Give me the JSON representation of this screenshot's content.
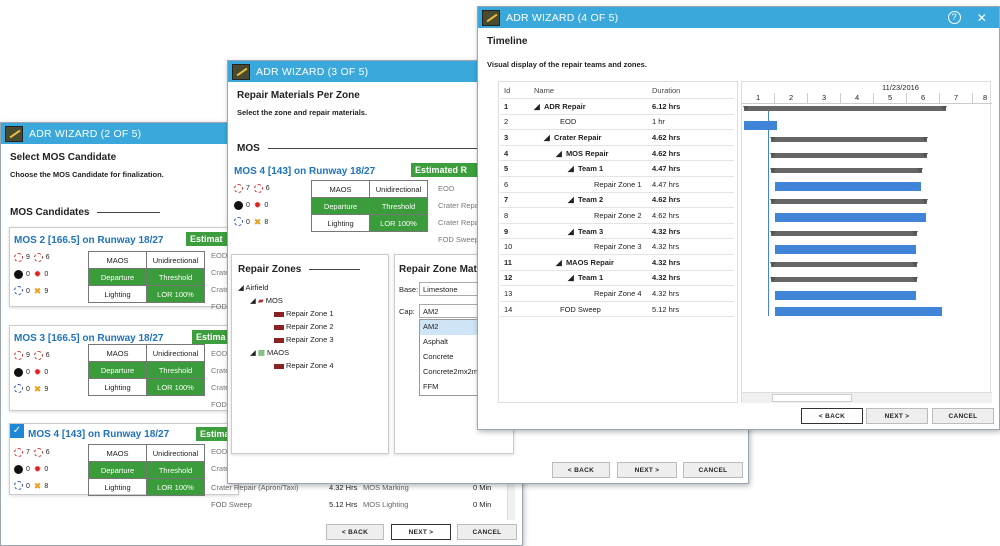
{
  "wiz2": {
    "title": "ADR WIZARD (2 OF 5)",
    "heading": "Select MOS Candidate",
    "sub": "Choose the MOS Candidate for finalization.",
    "section": "MOS Candidates",
    "cards": [
      {
        "name": "MOS 2 [166.5] on Runway 18/27",
        "est": "Estimat",
        "i1": "9",
        "i2": "6",
        "i3": "0",
        "i4": "0",
        "i5": "0",
        "i6": "9",
        "side": [
          "EOD",
          "Crate",
          "Crate",
          "FOD"
        ]
      },
      {
        "name": "MOS 3 [166.5] on Runway 18/27",
        "est": "Estima",
        "i1": "9",
        "i2": "6",
        "i3": "0",
        "i4": "0",
        "i5": "0",
        "i6": "9",
        "side": [
          "EOD",
          "Crate",
          "Crate",
          "FOD"
        ]
      },
      {
        "name": "MOS 4 [143] on Runway 18/27",
        "est": "Estima",
        "i1": "7",
        "i2": "6",
        "i3": "0",
        "i4": "0",
        "i5": "0",
        "i6": "8",
        "side": [
          "EOD",
          "Crate",
          "Crate",
          "FOD"
        ]
      }
    ],
    "grid": {
      "maos": "MAOS",
      "unidir": "Unidirectional",
      "departure": "Departure",
      "threshold": "Threshold",
      "lighting": "Lighting",
      "lor": "LOR 100%"
    },
    "extra": [
      {
        "a": "Crater Repair (Apron/Taxi)",
        "b": "4.32 Hrs",
        "c": "MOS Marking",
        "d": "0 Min"
      },
      {
        "a": "FOD Sweep",
        "b": "5.12 Hrs",
        "c": "MOS Lighting",
        "d": "0 Min"
      }
    ],
    "back": "< BACK",
    "next": "NEXT >",
    "cancel": "CANCEL"
  },
  "wiz3": {
    "title": "ADR WIZARD (3 OF 5)",
    "heading": "Repair Materials Per Zone",
    "sub": "Select the zone and repair materials.",
    "section": "MOS",
    "card": {
      "name": "MOS 4 [143] on Runway 18/27",
      "est": "Estimated R",
      "i1": "7",
      "i2": "6",
      "i3": "0",
      "i4": "0",
      "i5": "0",
      "i6": "8",
      "side": [
        "EOD",
        "Crater Repa",
        "Crater Repa",
        "FOD Sweep"
      ]
    },
    "zones_title": "Repair Zones",
    "tree": {
      "root": "Airfield",
      "mos": "MOS",
      "rz1": "Repair Zone 1",
      "rz2": "Repair Zone 2",
      "rz3": "Repair Zone 3",
      "maos": "MAOS",
      "rz4": "Repair Zone 4"
    },
    "mat_title": "Repair Zone Mat",
    "base_label": "Base:",
    "base_value": "Limestone",
    "cap_label": "Cap:",
    "cap_value": "AM2",
    "options": [
      "AM2",
      "Asphalt",
      "Concrete",
      "Concrete2mx2m",
      "FFM"
    ],
    "back": "< BACK",
    "next": "NEXT >",
    "cancel": "CANCEL"
  },
  "wiz4": {
    "title": "ADR WIZARD (4 OF 5)",
    "help": "?",
    "close": "✕",
    "heading": "Timeline",
    "sub": "Visual display of the repair teams and zones.",
    "cols": {
      "id": "Id",
      "name": "Name",
      "dur": "Duration"
    },
    "date": "11/23/2016",
    "ticks": [
      "1",
      "2",
      "3",
      "4",
      "5",
      "6",
      "7",
      "8"
    ],
    "rows": [
      {
        "id": "1",
        "name": "ADR Repair",
        "dur": "6.12 hrs"
      },
      {
        "id": "2",
        "name": "EOD",
        "dur": "1 hr"
      },
      {
        "id": "3",
        "name": "Crater Repair",
        "dur": "4.62 hrs"
      },
      {
        "id": "4",
        "name": "MOS Repair",
        "dur": "4.62 hrs"
      },
      {
        "id": "5",
        "name": "Team 1",
        "dur": "4.47 hrs"
      },
      {
        "id": "6",
        "name": "Repair Zone 1",
        "dur": "4.47 hrs"
      },
      {
        "id": "7",
        "name": "Team 2",
        "dur": "4.62 hrs"
      },
      {
        "id": "8",
        "name": "Repair Zone 2",
        "dur": "4.62 hrs"
      },
      {
        "id": "9",
        "name": "Team 3",
        "dur": "4.32 hrs"
      },
      {
        "id": "10",
        "name": "Repair Zone 3",
        "dur": "4.32 hrs"
      },
      {
        "id": "11",
        "name": "MAOS Repair",
        "dur": "4.32 hrs"
      },
      {
        "id": "12",
        "name": "Team 1",
        "dur": "4.32 hrs"
      },
      {
        "id": "13",
        "name": "Repair Zone 4",
        "dur": "4.32 hrs"
      },
      {
        "id": "14",
        "name": "FOD Sweep",
        "dur": "5.12 hrs"
      }
    ],
    "back": "< BACK",
    "next": "NEXT >",
    "cancel": "CANCEL"
  }
}
